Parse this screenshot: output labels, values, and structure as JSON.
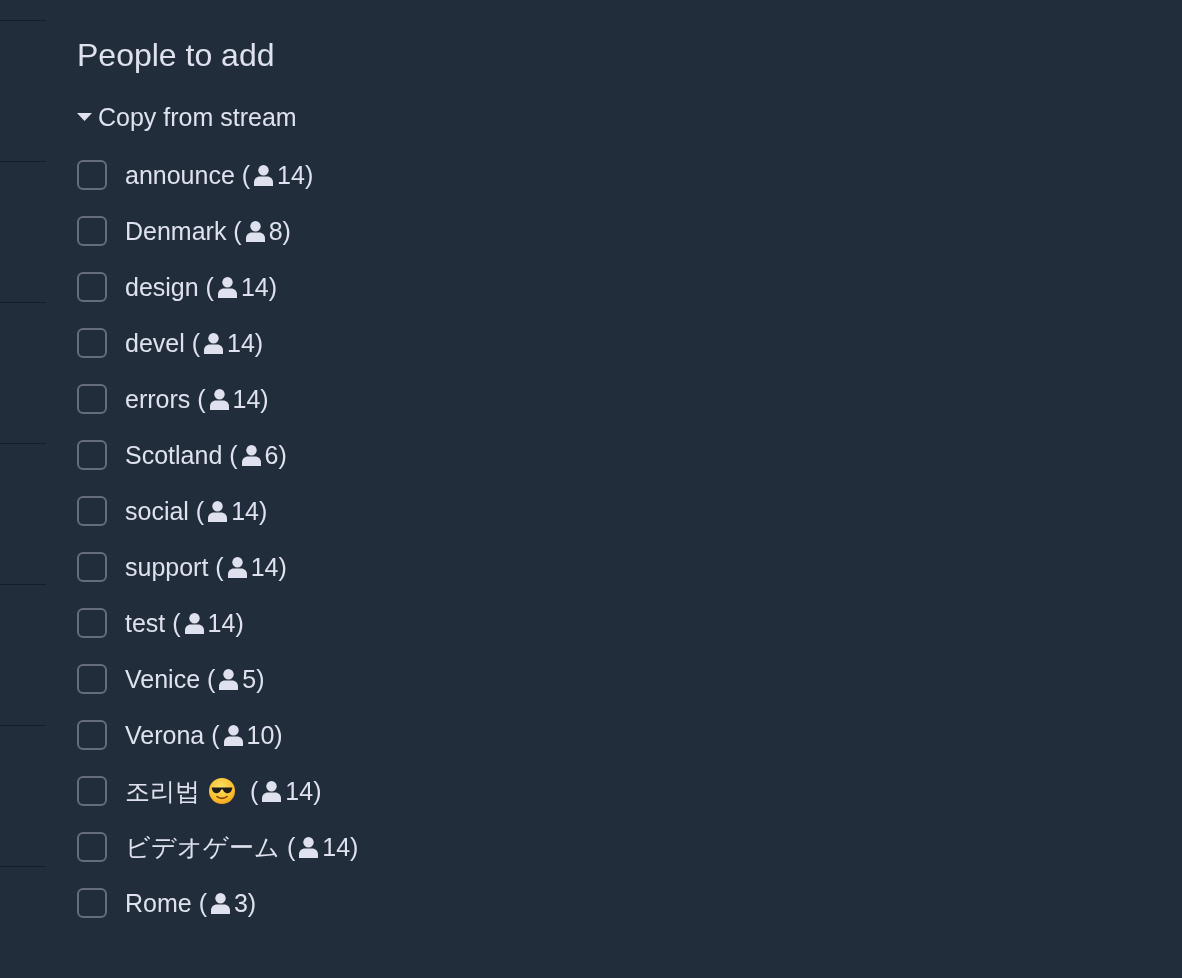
{
  "heading": "People to add",
  "copy_from_stream": {
    "label": "Copy from stream",
    "expanded": true,
    "streams": [
      {
        "kind": "plain",
        "name": "announce (",
        "count": "14)",
        "checked": false
      },
      {
        "kind": "plain",
        "name": "Denmark (",
        "count": "8)",
        "checked": false
      },
      {
        "kind": "plain",
        "name": "design (",
        "count": "14)",
        "checked": false
      },
      {
        "kind": "plain",
        "name": "devel (",
        "count": "14)",
        "checked": false
      },
      {
        "kind": "plain",
        "name": "errors (",
        "count": "14)",
        "checked": false
      },
      {
        "kind": "plain",
        "name": "Scotland (",
        "count": "6)",
        "checked": false
      },
      {
        "kind": "plain",
        "name": "social (",
        "count": "14)",
        "checked": false
      },
      {
        "kind": "plain",
        "name": "support (",
        "count": "14)",
        "checked": false
      },
      {
        "kind": "plain",
        "name": "test (",
        "count": "14)",
        "checked": false
      },
      {
        "kind": "plain",
        "name": "Venice (",
        "count": "5)",
        "checked": false
      },
      {
        "kind": "plain",
        "name": "Verona (",
        "count": "10)",
        "checked": false
      },
      {
        "kind": "emoji",
        "name": "조리법",
        "name_after": "(",
        "count": "14)",
        "checked": false
      },
      {
        "kind": "plain",
        "name": "ビデオゲーム (",
        "count": "14)",
        "checked": false
      },
      {
        "kind": "plain",
        "name": "Rome (",
        "count": "3)",
        "checked": false
      }
    ]
  }
}
